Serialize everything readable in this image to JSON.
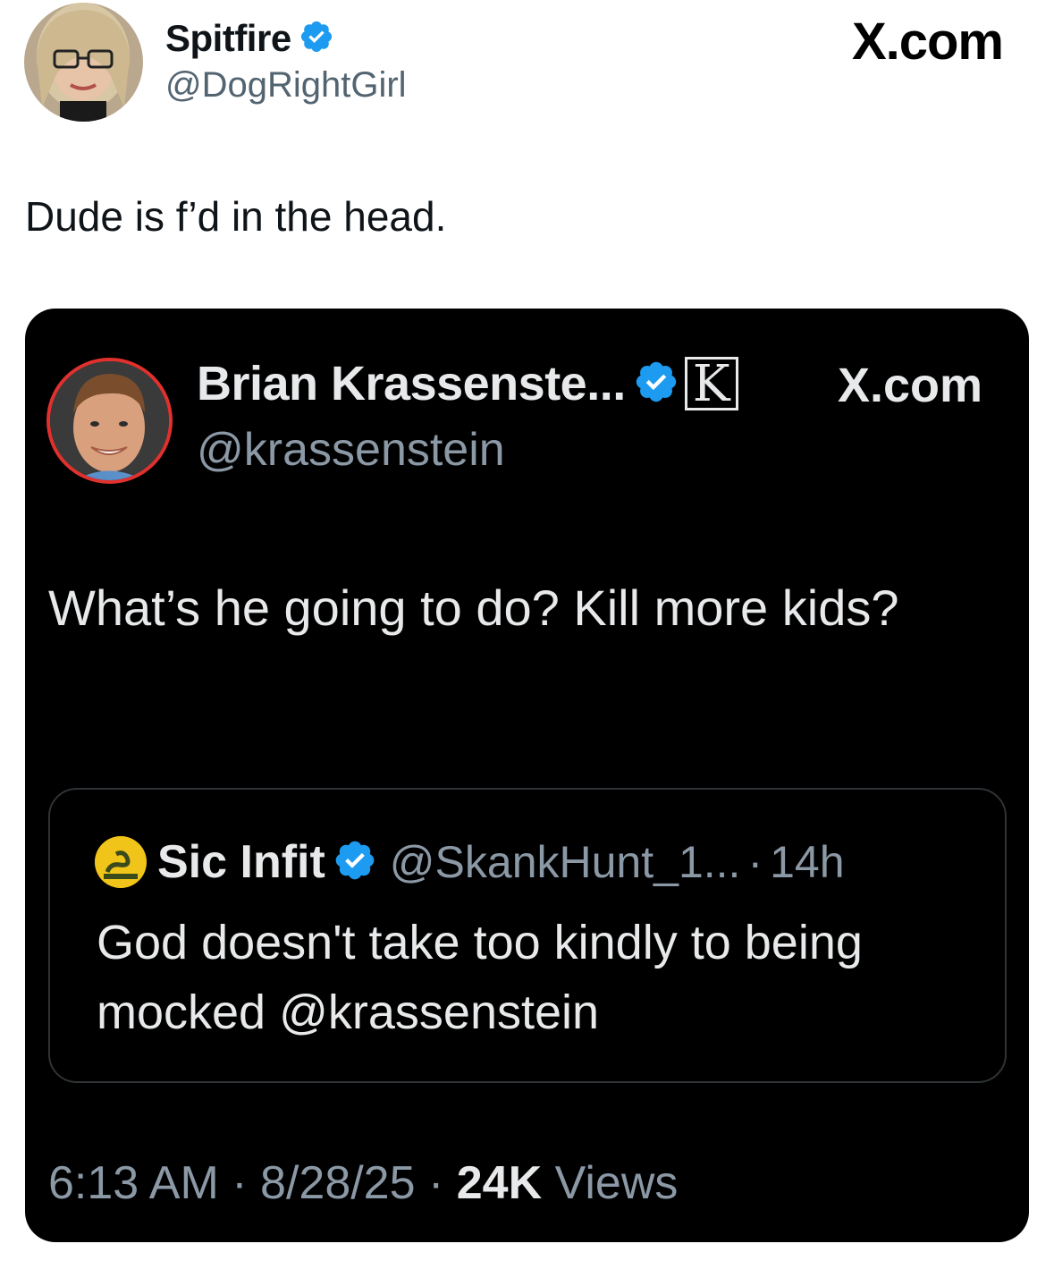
{
  "outer_tweet": {
    "display_name": "Spitfire",
    "handle": "@DogRightGirl",
    "brand": "X.com",
    "text": "Dude is f’d in the head."
  },
  "embedded_tweet": {
    "display_name": "Brian Krassenste...",
    "handle": "@krassenstein",
    "brand": "X.com",
    "badge_letter": "K",
    "text": "What’s he going to do?  Kill more kids?",
    "timestamp": "6:13 AM",
    "date": "8/28/25",
    "views_count": "24K",
    "views_label": "Views",
    "separator": "·"
  },
  "quoted_tweet": {
    "display_name": "Sic Infit",
    "handle": "@SkankHunt_1...",
    "separator": "·",
    "time": "14h",
    "text": "God doesn't take too kindly to being mocked @krassenstein"
  },
  "colors": {
    "verified_blue": "#1d9bf0",
    "dark_bg": "#000000",
    "avatar_ring": "#e0312e",
    "muted_text": "#8b98a5",
    "gadsden_yellow": "#f0c419"
  },
  "icons": {
    "verified": "verified-badge-icon",
    "affiliation": "k-badge-icon"
  }
}
